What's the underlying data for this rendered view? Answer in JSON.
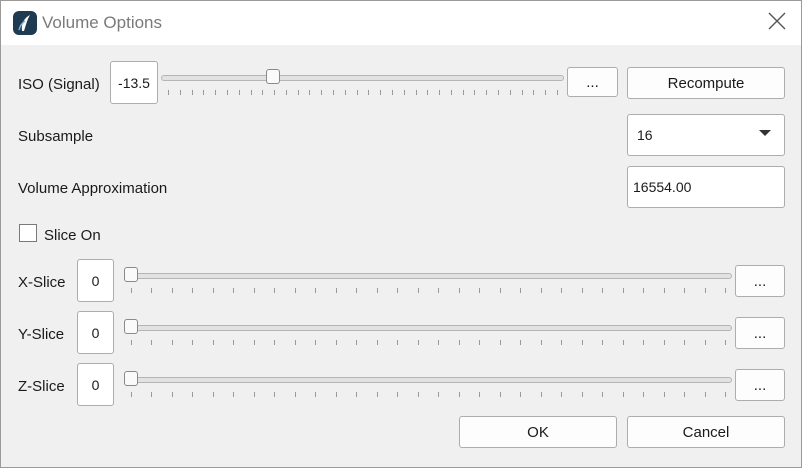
{
  "window": {
    "title": "Volume Options",
    "app_icon": "paraview-app-icon",
    "close_icon": "close-icon"
  },
  "iso": {
    "label": "ISO (Signal)",
    "value": "-13.5",
    "slider_fraction": 0.27,
    "more_label": "...",
    "recompute_label": "Recompute"
  },
  "subsample": {
    "label": "Subsample",
    "selected": "16"
  },
  "volume": {
    "label": "Volume Approximation",
    "value": "16554.00"
  },
  "slice_on": {
    "label": "Slice On",
    "checked": false
  },
  "slices": [
    {
      "label": "X-Slice",
      "value": "0",
      "slider_fraction": 0.0,
      "more_label": "..."
    },
    {
      "label": "Y-Slice",
      "value": "0",
      "slider_fraction": 0.0,
      "more_label": "..."
    },
    {
      "label": "Z-Slice",
      "value": "0",
      "slider_fraction": 0.0,
      "more_label": "..."
    }
  ],
  "buttons": {
    "ok": "OK",
    "cancel": "Cancel"
  }
}
